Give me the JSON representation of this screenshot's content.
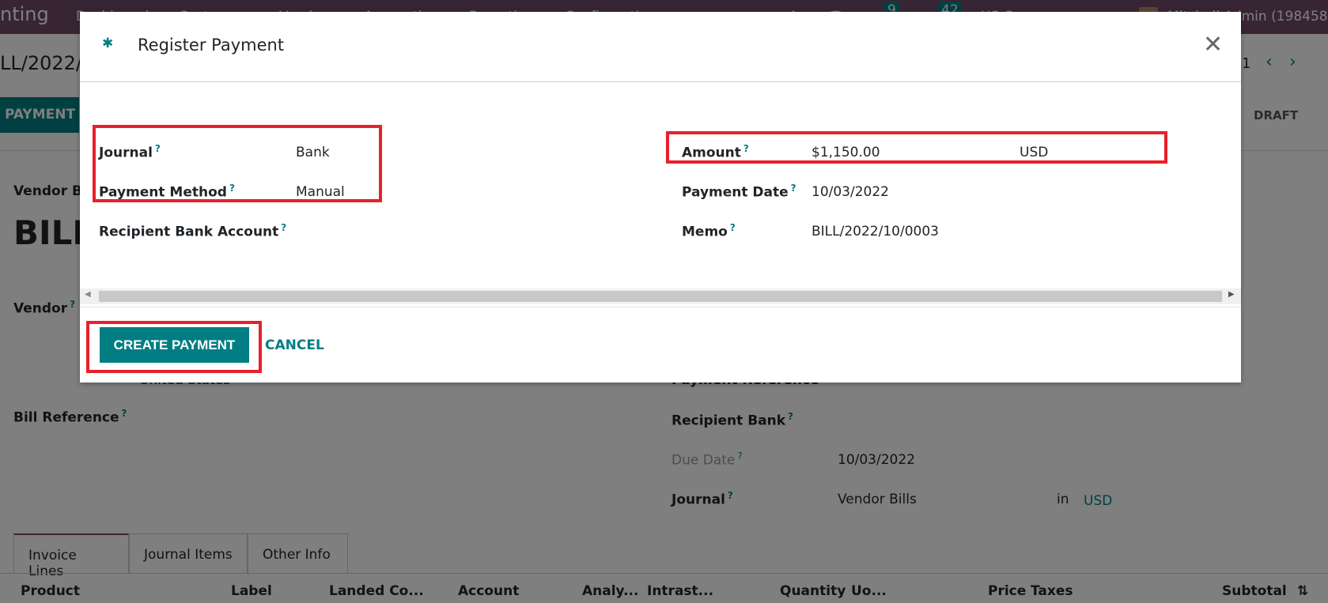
{
  "navbar": {
    "app": "nting",
    "menu": [
      "Dashboard",
      "Customers",
      "Vendors",
      "Accounting",
      "Reporting",
      "Configuration"
    ],
    "messages_badge": "9",
    "activities_badge": "42",
    "company": "US Company",
    "user": "Mitchell Admin (198458"
  },
  "record": {
    "breadcrumb": "LL/2022/",
    "pager": "1",
    "register_payment_btn": "PAYMENT",
    "status": "DRAFT",
    "type_label": "Vendor Bi",
    "name": "BILL",
    "vendor_label": "Vendor",
    "country": "United States",
    "bill_reference_label": "Bill Reference",
    "payment_reference_label": "Payment Reference",
    "recipient_bank_label": "Recipient Bank",
    "due_date_label": "Due Date",
    "due_date": "10/03/2022",
    "journal_label": "Journal",
    "journal": "Vendor Bills",
    "in": "in",
    "currency": "USD"
  },
  "tabs": [
    "Invoice Lines",
    "Journal Items",
    "Other Info"
  ],
  "columns": [
    "Product",
    "Label",
    "Landed Co...",
    "Account",
    "Analy...",
    "Intrast...",
    "Quantity",
    "Uo...",
    "Price",
    "Taxes",
    "Subtotal"
  ],
  "dialog": {
    "title": "Register Payment",
    "journal_label": "Journal",
    "journal": "Bank",
    "payment_method_label": "Payment Method",
    "payment_method": "Manual",
    "recipient_bank_label": "Recipient Bank Account",
    "amount_label": "Amount",
    "amount": "$1,150.00",
    "currency": "USD",
    "payment_date_label": "Payment Date",
    "payment_date": "10/03/2022",
    "memo_label": "Memo",
    "memo": "BILL/2022/10/0003",
    "create_label": "CREATE PAYMENT",
    "cancel_label": "CANCEL",
    "help": "?"
  },
  "colors": {
    "brand": "#714b67",
    "accent": "#017e84",
    "highlight": "#e8202a"
  }
}
